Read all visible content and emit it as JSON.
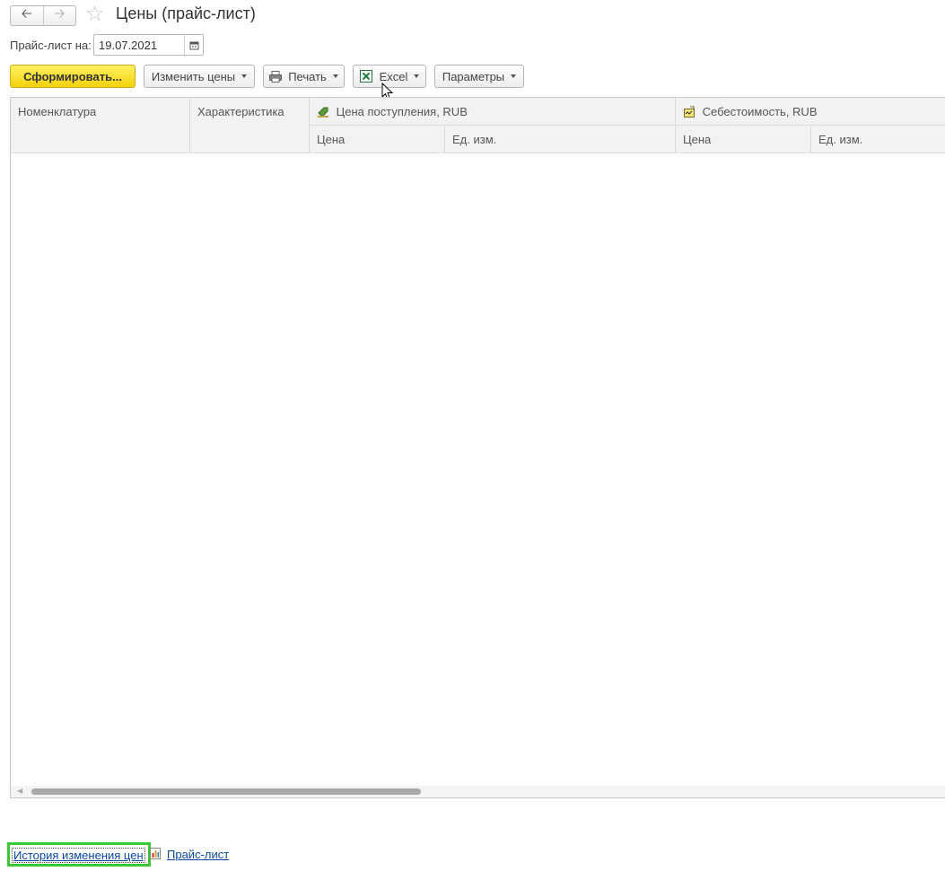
{
  "window": {
    "title": "Цены (прайс-лист)",
    "back_icon": "arrow-left-icon",
    "forward_icon": "arrow-right-icon",
    "favorite_icon": "star-icon"
  },
  "filter": {
    "date_label": "Прайс-лист на:",
    "date_value": "19.07.2021",
    "calendar_icon": "calendar-icon"
  },
  "toolbar": {
    "generate_label": "Сформировать...",
    "change_prices_label": "Изменить цены",
    "print_label": "Печать",
    "excel_label": "Excel",
    "params_label": "Параметры"
  },
  "table": {
    "col_nomenclature": "Номенклатура",
    "col_characteristic": "Характеристика",
    "group_purchase": "Цена поступления, RUB",
    "group_cost": "Себестоимость, RUB",
    "sub_price": "Цена",
    "sub_unit": "Ед. изм.",
    "rows": []
  },
  "footer": {
    "history_link": "История изменения цен",
    "pricelist_link": "Прайс-лист"
  },
  "colors": {
    "primary_button": "#f3d20b",
    "focus_outline": "#3cc832",
    "link": "#0a48a3",
    "excel_green": "#1d7a3c"
  }
}
